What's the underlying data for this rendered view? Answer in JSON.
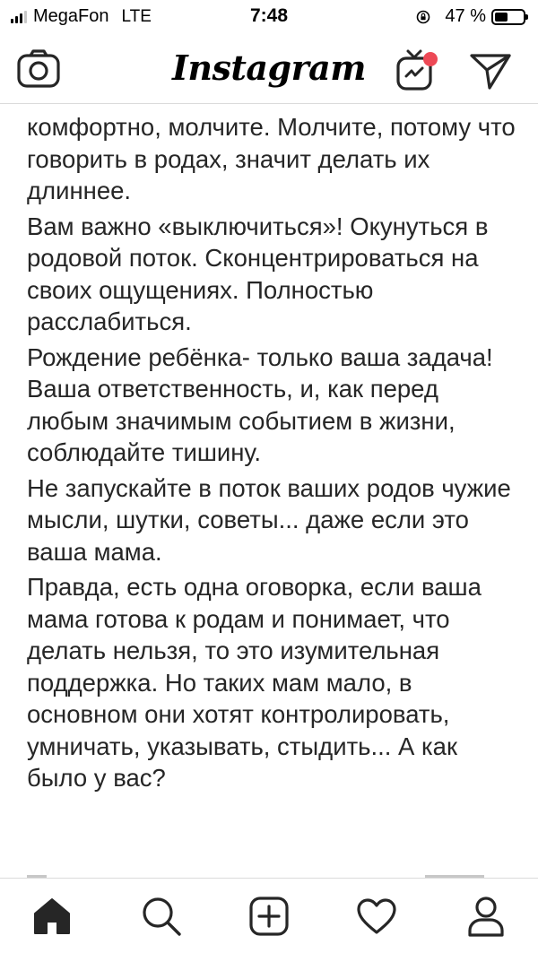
{
  "status_bar": {
    "carrier": "MegaFon",
    "network": "LTE",
    "time": "7:48",
    "battery_text": "47 %",
    "battery_level": 0.47
  },
  "header": {
    "logo_text": "Instagram",
    "icons": {
      "left": "camera-icon",
      "igtv": "igtv-icon",
      "direct": "direct-message-icon"
    },
    "igtv_badge_color": "#ed4956"
  },
  "caption": {
    "paragraphs": [
      "комфортно, молчите. Молчите, потому что говорить в родах, значит делать их длиннее.",
      "Вам важно «выключиться»! Окунуться в родовой поток. Сконцентрироваться на своих ощущениях. Полностью расслабиться.",
      "Рождение ребёнка- только ваша задача! Ваша ответственность, и, как перед любым значимым событием в жизни, соблюдайте тишину.",
      "Не запускайте в поток ваших родов чужие мысли, шутки, советы... даже если это ваша мама.",
      "Правда, есть одна оговорка, если ваша мама готова к родам и понимает, что делать нельзя, то это изумительная поддержка. Но таких мам мало, в основном они хотят контролировать, умничать, указывать, стыдить... А как было у вас?"
    ]
  },
  "tab_bar": {
    "tabs": [
      {
        "name": "home",
        "icon": "home-icon",
        "active": true
      },
      {
        "name": "search",
        "icon": "search-icon",
        "active": false
      },
      {
        "name": "new-post",
        "icon": "add-post-icon",
        "active": false
      },
      {
        "name": "activity",
        "icon": "heart-icon",
        "active": false
      },
      {
        "name": "profile",
        "icon": "profile-icon",
        "active": false
      }
    ]
  },
  "colors": {
    "text": "#262626",
    "divider": "#dbdbdb",
    "badge": "#ed4956"
  }
}
